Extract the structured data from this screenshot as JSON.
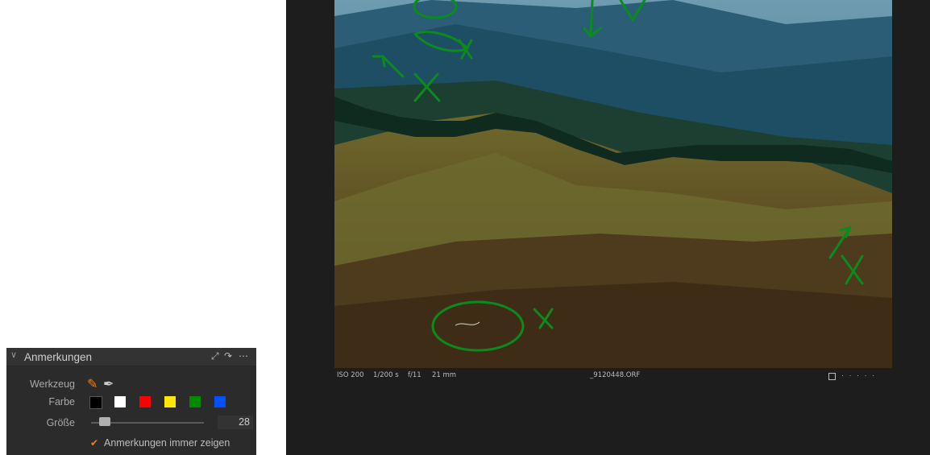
{
  "panel": {
    "title": "Anmerkungen",
    "icons": [
      "chevron-down-icon",
      "expand-icon",
      "reset-icon",
      "more-icon"
    ],
    "tool_label": "Werkzeug",
    "tools": [
      "pencil-icon",
      "eraser-icon"
    ],
    "color_label": "Farbe",
    "colors": [
      "#000000",
      "#ffffff",
      "#ff0000",
      "#ffe600",
      "#008a00",
      "#0050ff"
    ],
    "size_label": "Größe",
    "size_value": "28",
    "always_show_label": "Anmerkungen immer zeigen",
    "always_show_checked": true
  },
  "viewer": {
    "iso": "ISO 200",
    "shutter": "1/200 s",
    "aperture": "f/11",
    "focal_length": "21 mm",
    "filename": "_9120448.ORF",
    "dots": "· · · · ·"
  }
}
